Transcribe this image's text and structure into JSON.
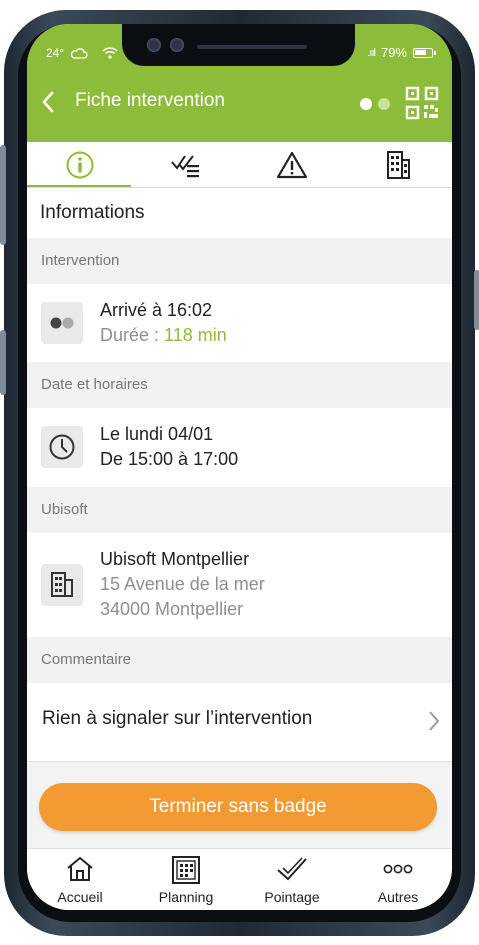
{
  "status_bar": {
    "temperature": "24°",
    "signal": ".ııl",
    "battery_percent": "79%",
    "battery_level": 0.79,
    "weather_icon": "cloud-icon",
    "wifi_icon": "wifi-icon"
  },
  "header": {
    "title": "Fiche intervention",
    "back_icon": "chevron-left-icon",
    "toggle_icon": "toggle-dots-icon",
    "qr_icon": "qr-code-icon"
  },
  "tabs": [
    {
      "icon": "info-icon",
      "active": true
    },
    {
      "icon": "checklist-icon",
      "active": false
    },
    {
      "icon": "warning-icon",
      "active": false
    },
    {
      "icon": "building-icon",
      "active": false
    }
  ],
  "section_title": "Informations",
  "intervention": {
    "header": "Intervention",
    "arrival": "Arrivé à 16:02",
    "duration_label": "Durée : ",
    "duration_value": "118 min"
  },
  "schedule": {
    "header": "Date et horaires",
    "date": "Le lundi 04/01",
    "hours": "De 15:00 à 17:00"
  },
  "company": {
    "header": "Ubisoft",
    "name": "Ubisoft Montpellier",
    "street": "15 Avenue de la mer",
    "city": "34000 Montpellier"
  },
  "comment": {
    "header": "Commentaire",
    "text": "Rien à signaler sur l’intervention"
  },
  "cta": {
    "label": "Terminer sans badge"
  },
  "bottom_nav": [
    {
      "label": "Accueil",
      "icon": "home-icon"
    },
    {
      "label": "Planning",
      "icon": "calendar-icon"
    },
    {
      "label": "Pointage",
      "icon": "check-badge-icon"
    },
    {
      "label": "Autres",
      "icon": "more-icon"
    }
  ],
  "colors": {
    "brand": "#8dbc3a",
    "accent": "#f39a33",
    "background": "#f3f3f3"
  }
}
